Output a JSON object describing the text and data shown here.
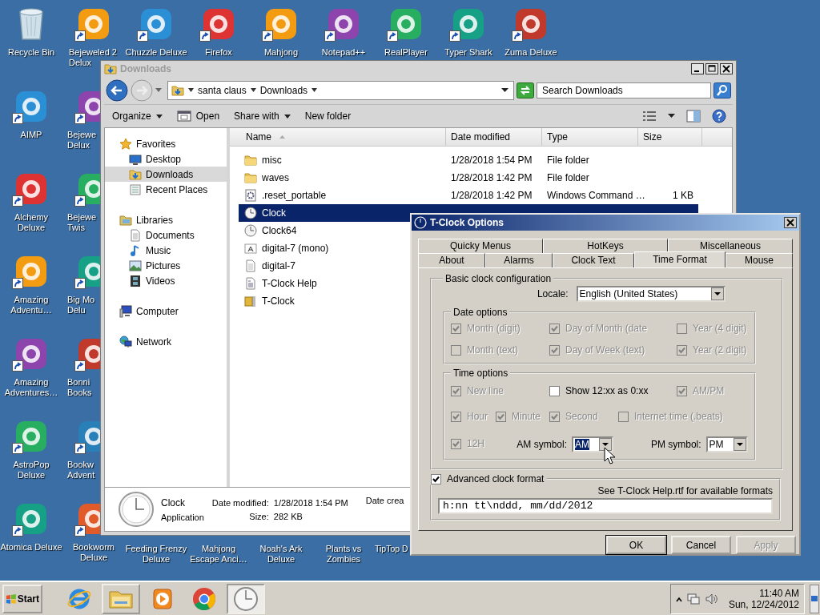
{
  "desktop": {
    "column_1": [
      {
        "label": "Recycle Bin",
        "kind": "bin",
        "shortcut": false
      },
      {
        "label": "AIMP",
        "kind": "app",
        "shortcut": true
      },
      {
        "label": "Alchemy Deluxe",
        "kind": "app",
        "shortcut": true
      },
      {
        "label": "Amazing Adventu…",
        "kind": "app",
        "shortcut": true
      },
      {
        "label": "Amazing Adventures…",
        "kind": "app",
        "shortcut": true
      },
      {
        "label": "AstroPop Deluxe",
        "kind": "app",
        "shortcut": true
      },
      {
        "label": "Atomica Deluxe",
        "kind": "app",
        "shortcut": true
      }
    ],
    "column_2": [
      {
        "label": "Bejeweled 2 Delux",
        "kind": "app",
        "shortcut": true
      },
      {
        "label": "Bejewe Delux",
        "kind": "app",
        "shortcut": true
      },
      {
        "label": "Bejewe Twis",
        "kind": "app",
        "shortcut": true
      },
      {
        "label": "Big Mo Delu",
        "kind": "app",
        "shortcut": true
      },
      {
        "label": "Bonni Books",
        "kind": "app",
        "shortcut": true
      },
      {
        "label": "Bookw Advent",
        "kind": "app",
        "shortcut": true
      },
      {
        "label": "Bookworm Deluxe",
        "kind": "app",
        "shortcut": true
      }
    ],
    "top_row": [
      {
        "label": "Chuzzle Deluxe",
        "kind": "app",
        "shortcut": true
      },
      {
        "label": "Firefox",
        "kind": "app",
        "shortcut": true
      },
      {
        "label": "Mahjong",
        "kind": "app",
        "shortcut": true
      },
      {
        "label": "Notepad++",
        "kind": "app",
        "shortcut": true
      },
      {
        "label": "RealPlayer",
        "kind": "app",
        "shortcut": true
      },
      {
        "label": "Typer Shark",
        "kind": "app",
        "shortcut": true
      },
      {
        "label": "Zuma Deluxe",
        "kind": "app",
        "shortcut": true
      }
    ],
    "bottom_row": [
      {
        "label": "Feeding Frenzy Deluxe"
      },
      {
        "label": "Mahjong Escape Anci…"
      },
      {
        "label": "Noah's Ark Deluxe"
      },
      {
        "label": "Plants vs Zombies"
      },
      {
        "label": "TipTop D"
      }
    ]
  },
  "explorer": {
    "title": "Downloads",
    "active": false,
    "breadcrumb": [
      "santa claus",
      "Downloads"
    ],
    "search": {
      "placeholder": "Search Downloads"
    },
    "toolbar": [
      {
        "label": "Organize",
        "kind": "menu"
      },
      {
        "label": "Open",
        "kind": "open"
      },
      {
        "label": "Share with",
        "kind": "menu"
      },
      {
        "label": "New folder",
        "kind": "plain"
      }
    ],
    "nav": [
      {
        "label": "Favorites",
        "kind": "star",
        "selected": false,
        "children": [
          {
            "label": "Desktop",
            "kind": "desktop",
            "selected": false
          },
          {
            "label": "Downloads",
            "kind": "downloads",
            "selected": true
          },
          {
            "label": "Recent Places",
            "kind": "recent",
            "selected": false
          }
        ]
      },
      {
        "label": "Libraries",
        "kind": "library",
        "selected": false,
        "children": [
          {
            "label": "Documents",
            "kind": "document",
            "selected": false
          },
          {
            "label": "Music",
            "kind": "music",
            "selected": false
          },
          {
            "label": "Pictures",
            "kind": "pictures",
            "selected": false
          },
          {
            "label": "Videos",
            "kind": "videos",
            "selected": false
          }
        ]
      },
      {
        "label": "Computer",
        "kind": "computer",
        "selected": false
      },
      {
        "label": "Network",
        "kind": "network",
        "selected": false
      }
    ],
    "columns": [
      {
        "label": "Name",
        "sorted": true
      },
      {
        "label": "Date modified",
        "sorted": false
      },
      {
        "label": "Type",
        "sorted": false
      },
      {
        "label": "Size",
        "sorted": false
      }
    ],
    "files": [
      {
        "name": "misc",
        "kind": "folder",
        "date": "1/28/2018 1:54 PM",
        "type": "File folder",
        "selected": false
      },
      {
        "name": "waves",
        "kind": "folder",
        "date": "1/28/2018 1:42 PM",
        "type": "File folder",
        "selected": false
      },
      {
        "name": ".reset_portable",
        "kind": "script",
        "date": "1/28/2018 1:42 PM",
        "type": "Windows Command …",
        "size": "1 KB",
        "selected": false
      },
      {
        "name": "Clock",
        "kind": "clock",
        "selected": true
      },
      {
        "name": "Clock64",
        "kind": "clock",
        "selected": false
      },
      {
        "name": "digital-7 (mono)",
        "kind": "font",
        "selected": false
      },
      {
        "name": "digital-7",
        "kind": "text",
        "selected": false
      },
      {
        "name": "T-Clock Help",
        "kind": "help",
        "selected": false
      },
      {
        "name": "T-Clock",
        "kind": "archive",
        "selected": false
      }
    ],
    "details": {
      "name": "Clock",
      "type": "Application",
      "date_label": "Date modified:",
      "date": "1/28/2018 1:54 PM",
      "size_label": "Size:",
      "size": "282 KB",
      "created_label": "Date crea"
    }
  },
  "dialog": {
    "title": "T-Clock Options",
    "tab_rows": [
      [
        {
          "label": "Quicky Menus",
          "selected": false
        },
        {
          "label": "HotKeys",
          "selected": false
        },
        {
          "label": "Miscellaneous",
          "selected": false
        }
      ],
      [
        {
          "label": "About",
          "selected": false
        },
        {
          "label": "Alarms",
          "selected": false
        },
        {
          "label": "Clock Text",
          "selected": false
        },
        {
          "label": "Time Format",
          "selected": true
        },
        {
          "label": "Mouse",
          "selected": false
        }
      ]
    ],
    "basic": {
      "title": "Basic clock configuration",
      "locale_label": "Locale:",
      "locale": "English (United States)"
    },
    "date_options": {
      "title": "Date options",
      "items": [
        {
          "label": "Month (digit)",
          "checked": true,
          "disabled": true
        },
        {
          "label": "Day of Month (date",
          "checked": true,
          "disabled": true
        },
        {
          "label": "Year (4 digit)",
          "checked": false,
          "disabled": true
        },
        {
          "label": "Month (text)",
          "checked": false,
          "disabled": true
        },
        {
          "label": "Day of Week (text)",
          "checked": true,
          "disabled": true
        },
        {
          "label": "Year (2 digit)",
          "checked": true,
          "disabled": true
        }
      ]
    },
    "time_options": {
      "title": "Time options",
      "items": [
        {
          "label": "New line",
          "checked": true,
          "disabled": true
        },
        {
          "label": "Show 12:xx as 0:xx",
          "checked": false,
          "disabled": false
        },
        {
          "label": "AM/PM",
          "checked": true,
          "disabled": true
        },
        {
          "label": "Hour",
          "checked": true,
          "disabled": true
        },
        {
          "label": "Minute",
          "checked": true,
          "disabled": true
        },
        {
          "label": "Second",
          "checked": true,
          "disabled": true
        },
        {
          "label": "Internet time (.beats)",
          "checked": false,
          "disabled": true
        },
        {
          "label": "12H",
          "checked": true,
          "disabled": true
        }
      ],
      "am_label": "AM symbol:",
      "am": "AM",
      "pm_label": "PM symbol:",
      "pm": "PM"
    },
    "advanced": {
      "label": "Advanced clock format",
      "checked": true,
      "hint": "See T-Clock Help.rtf for available formats",
      "format": "h:nn tt\\nddd, mm/dd/2012"
    },
    "buttons": [
      {
        "label": "OK",
        "default": true,
        "disabled": false
      },
      {
        "label": "Cancel",
        "default": false,
        "disabled": false
      },
      {
        "label": "Apply",
        "default": false,
        "disabled": true
      }
    ]
  },
  "taskbar": {
    "start": "Start",
    "apps": [
      {
        "kind": "ie",
        "open": false,
        "selected": false
      },
      {
        "kind": "explorer",
        "open": true,
        "selected": false
      },
      {
        "kind": "media",
        "open": false,
        "selected": false
      },
      {
        "kind": "chrome",
        "open": false,
        "selected": false
      },
      {
        "kind": "clock",
        "open": true,
        "selected": true
      }
    ],
    "time": "11:40 AM",
    "date": "Sun, 12/24/2012"
  }
}
